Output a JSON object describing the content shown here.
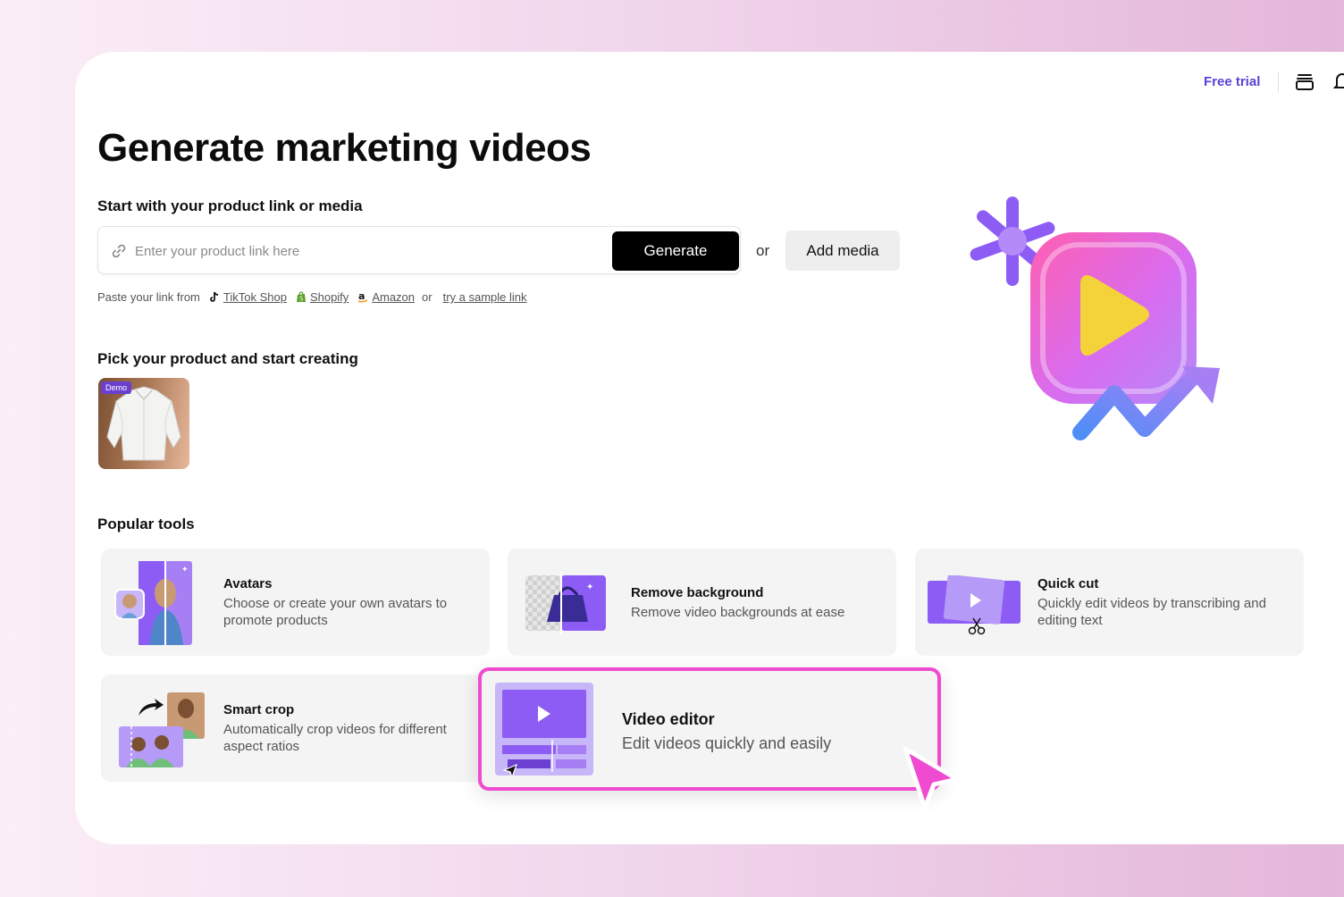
{
  "header": {
    "free_trial": "Free trial",
    "icons": [
      "stack-icon",
      "bell-icon"
    ]
  },
  "page": {
    "title": "Generate marketing videos"
  },
  "product_link": {
    "section_label": "Start with your product link or media",
    "placeholder": "Enter your product link here",
    "value": "",
    "generate_label": "Generate",
    "or_text": "or",
    "add_media_label": "Add media",
    "paste_prefix": "Paste your link from",
    "sources": [
      {
        "label": "TikTok Shop",
        "icon": "tiktok-icon"
      },
      {
        "label": "Shopify",
        "icon": "shopify-icon"
      },
      {
        "label": "Amazon",
        "icon": "amazon-icon"
      }
    ],
    "or_small": "or",
    "sample_link": "try a sample link"
  },
  "pick_product": {
    "section_label": "Pick your product and start creating",
    "demo_badge": "Demo"
  },
  "popular_tools": {
    "section_label": "Popular tools",
    "tools": [
      {
        "title": "Avatars",
        "desc": "Choose or create your own avatars to promote products"
      },
      {
        "title": "Remove background",
        "desc": "Remove video backgrounds at ease"
      },
      {
        "title": "Quick cut",
        "desc": "Quickly edit videos by transcribing and editing text"
      },
      {
        "title": "Smart crop",
        "desc": "Automatically crop videos for different aspect ratios"
      },
      {
        "title": "Video editor",
        "desc": "Edit videos quickly and easily"
      }
    ]
  },
  "colors": {
    "accent": "#5b3fd6",
    "highlight_border": "#f04ad0",
    "card_bg": "#f4f4f4",
    "purple": "#8c5cf5"
  }
}
